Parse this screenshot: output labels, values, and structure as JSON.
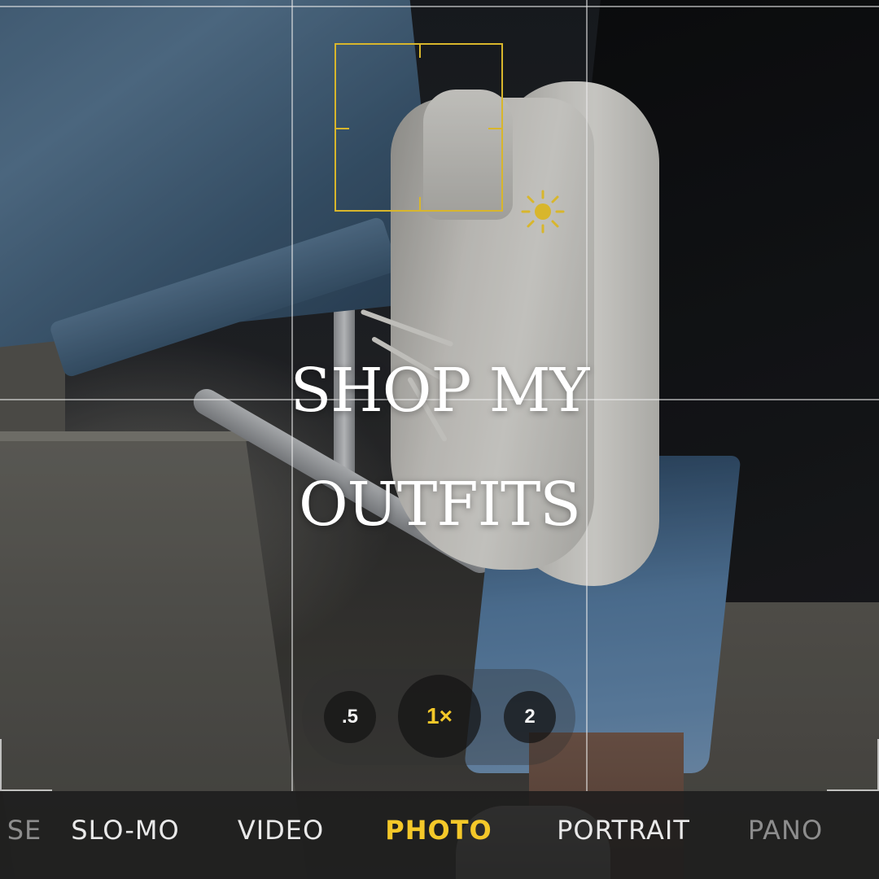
{
  "overlay": {
    "title_line1": "SHOP MY",
    "title_line2": "OUTFITS"
  },
  "exposure": {
    "icon": "sun-icon"
  },
  "zoom": {
    "options": [
      ".5",
      "1×",
      "2"
    ],
    "selected": "1×"
  },
  "modes": {
    "items": [
      "SE",
      "SLO-MO",
      "VIDEO",
      "PHOTO",
      "PORTRAIT",
      "PANO"
    ],
    "active": "PHOTO"
  },
  "colors": {
    "accent_yellow": "#f4c829",
    "focus_box": "#d8b62c",
    "grid_line": "#ebebeb",
    "mode_bar_bg": "#1c1c1c"
  }
}
